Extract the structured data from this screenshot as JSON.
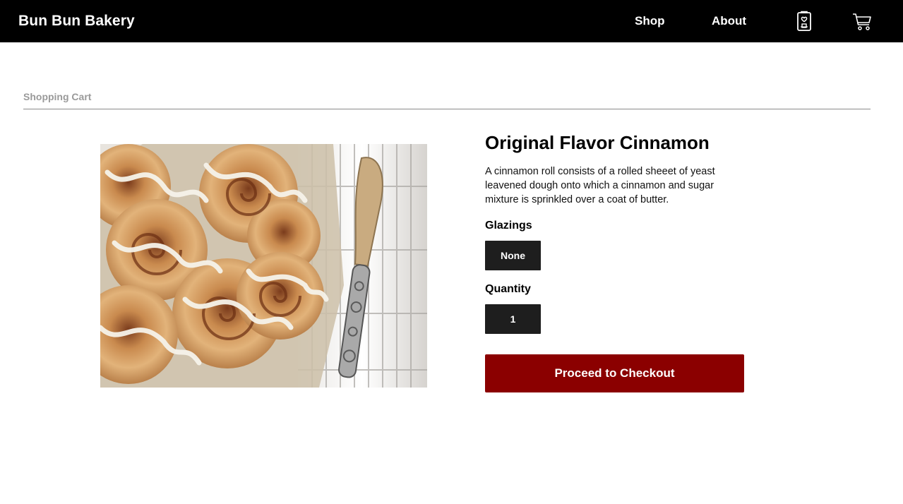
{
  "header": {
    "brand": "Bun Bun Bakery",
    "nav": {
      "shop": "Shop",
      "about": "About"
    },
    "icons": {
      "wishlist": "wishlist-icon",
      "cart": "cart-icon"
    }
  },
  "breadcrumb": "Shopping Cart",
  "product": {
    "title": "Original Flavor Cinnamon",
    "description": "A cinnamon roll consists  of a rolled sheeet of yeast leavened dough onto which a cinnamon and sugar mixture is sprinkled over a coat of butter.",
    "image_alt": "cinnamon-rolls-photo",
    "glazing_label": "Glazings",
    "glazing_value": "None",
    "quantity_label": "Quantity",
    "quantity_value": "1",
    "checkout_label": "Proceed to Checkout"
  },
  "colors": {
    "header_bg": "#000000",
    "checkout_bg": "#8b0000",
    "option_bg": "#1e1e1e",
    "breadcrumb_text": "#9a9a9a"
  }
}
